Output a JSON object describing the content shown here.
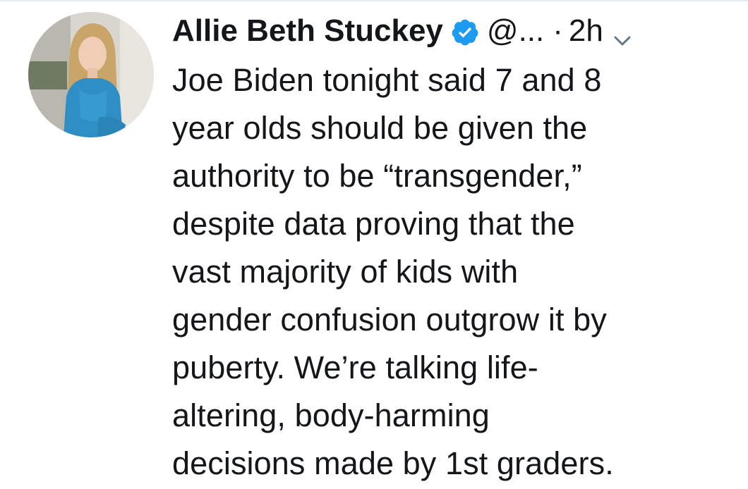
{
  "tweet": {
    "author": {
      "display_name": "Allie Beth Stuckey",
      "handle": "@...",
      "verified_icon": "verified-badge-icon",
      "avatar_icon": "profile-photo"
    },
    "separator": "·",
    "time": "2h",
    "menu_icon": "chevron-down-icon",
    "text": "Joe Biden tonight said 7 and 8\nyear olds should be given the\nauthority to be “transgender,”\ndespite data proving that the\nvast majority of kids with\ngender confusion outgrow it by\npuberty. We’re talking life-\naltering, body-harming\ndecisions made by 1st graders.",
    "colors": {
      "text": "#14171a",
      "verified_blue": "#1da1f2",
      "muted": "#657786"
    }
  }
}
